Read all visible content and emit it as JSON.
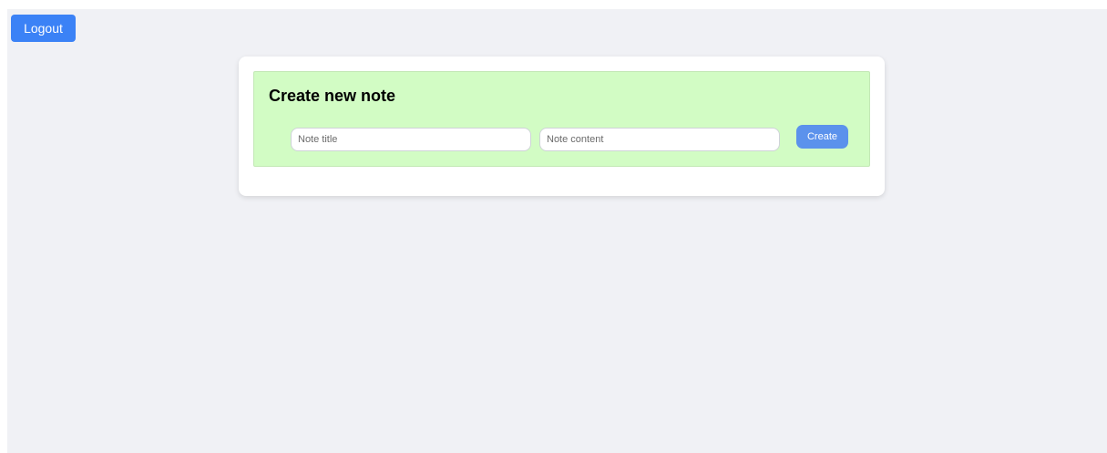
{
  "header": {
    "logout_label": "Logout"
  },
  "note_form": {
    "title": "Create new note",
    "title_field": {
      "value": "",
      "placeholder": "Note title"
    },
    "content_field": {
      "value": "",
      "placeholder": "Note content"
    },
    "create_label": "Create"
  },
  "colors": {
    "page_background": "#f0f1f5",
    "logout_button": "#3b82f6",
    "form_background": "#d2fcc4",
    "create_button": "#5b92ec"
  }
}
